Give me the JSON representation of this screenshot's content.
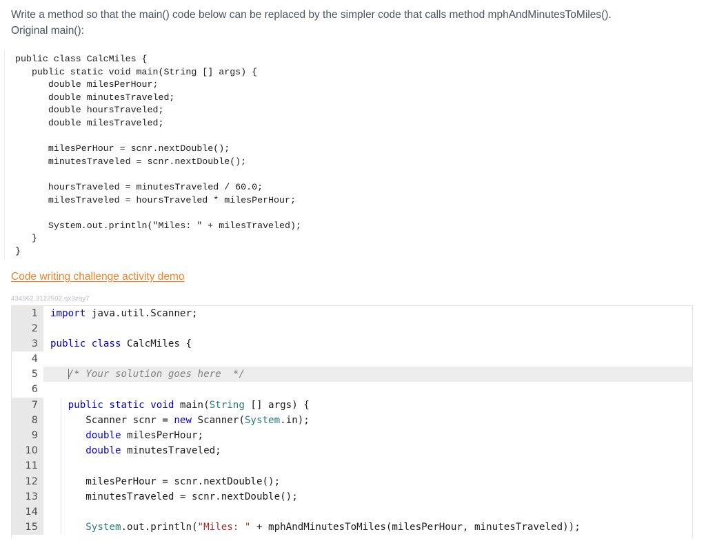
{
  "prompt": {
    "line1": "Write a method so that the main() code below can be replaced by the simpler code that calls method mphAndMinutesToMiles().",
    "line2": "Original main():"
  },
  "original_code": "public class CalcMiles {\n   public static void main(String [] args) {\n      double milesPerHour;\n      double minutesTraveled;\n      double hoursTraveled;\n      double milesTraveled;\n\n      milesPerHour = scnr.nextDouble();\n      minutesTraveled = scnr.nextDouble();\n\n      hoursTraveled = minutesTraveled / 60.0;\n      milesTraveled = hoursTraveled * milesPerHour;\n\n      System.out.println(\"Miles: \" + milesTraveled);\n   }\n}",
  "demo_link": {
    "label": "Code writing challenge activity demo",
    "color": "#f28123"
  },
  "activity_id": "434962.3122502.qx3zqy7",
  "editor": {
    "highlight_color": "#ededed",
    "gutter_color": "#e8e8e8",
    "keyword_color": "#0000cd",
    "type_color": "#2a7a7a",
    "string_color": "#a52a2a",
    "comment_color": "#808080",
    "lines": [
      {
        "num": "1",
        "gutter": "readonly",
        "tokens": [
          {
            "t": "import",
            "c": "kw"
          },
          {
            "t": " java.util.Scanner;",
            "c": "plain"
          }
        ]
      },
      {
        "num": "2",
        "gutter": "readonly",
        "tokens": []
      },
      {
        "num": "3",
        "gutter": "readonly",
        "tokens": [
          {
            "t": "public class",
            "c": "kw"
          },
          {
            "t": " CalcMiles {",
            "c": "plain"
          }
        ]
      },
      {
        "num": "4",
        "gutter": "editable",
        "tokens": []
      },
      {
        "num": "5",
        "gutter": "editable",
        "solution": true,
        "tokens": [
          {
            "t": "   /* Your solution goes here  */",
            "c": "cmt"
          }
        ]
      },
      {
        "num": "6",
        "gutter": "editable",
        "tokens": []
      },
      {
        "num": "7",
        "gutter": "readonly",
        "tokens": [
          {
            "t": "   ",
            "c": "plain"
          },
          {
            "t": "public static void",
            "c": "kw"
          },
          {
            "t": " main(",
            "c": "plain"
          },
          {
            "t": "String",
            "c": "type"
          },
          {
            "t": " [] args) {",
            "c": "plain"
          }
        ]
      },
      {
        "num": "8",
        "gutter": "readonly",
        "tokens": [
          {
            "t": "      Scanner scnr = ",
            "c": "plain"
          },
          {
            "t": "new",
            "c": "kw"
          },
          {
            "t": " Scanner(",
            "c": "plain"
          },
          {
            "t": "System",
            "c": "type"
          },
          {
            "t": ".in);",
            "c": "plain"
          }
        ]
      },
      {
        "num": "9",
        "gutter": "readonly",
        "tokens": [
          {
            "t": "      ",
            "c": "plain"
          },
          {
            "t": "double",
            "c": "kw"
          },
          {
            "t": " milesPerHour;",
            "c": "plain"
          }
        ]
      },
      {
        "num": "10",
        "gutter": "readonly",
        "tokens": [
          {
            "t": "      ",
            "c": "plain"
          },
          {
            "t": "double",
            "c": "kw"
          },
          {
            "t": " minutesTraveled;",
            "c": "plain"
          }
        ]
      },
      {
        "num": "11",
        "gutter": "readonly",
        "tokens": []
      },
      {
        "num": "12",
        "gutter": "readonly",
        "tokens": [
          {
            "t": "      milesPerHour = scnr.nextDouble();",
            "c": "plain"
          }
        ]
      },
      {
        "num": "13",
        "gutter": "readonly",
        "tokens": [
          {
            "t": "      minutesTraveled = scnr.nextDouble();",
            "c": "plain"
          }
        ]
      },
      {
        "num": "14",
        "gutter": "readonly",
        "tokens": []
      },
      {
        "num": "15",
        "gutter": "readonly",
        "tokens": [
          {
            "t": "      ",
            "c": "plain"
          },
          {
            "t": "System",
            "c": "type"
          },
          {
            "t": ".out.println(",
            "c": "plain"
          },
          {
            "t": "\"Miles: \"",
            "c": "str"
          },
          {
            "t": " + mphAndMinutesToMiles(milesPerHour, minutesTraveled));",
            "c": "plain"
          }
        ]
      }
    ]
  }
}
